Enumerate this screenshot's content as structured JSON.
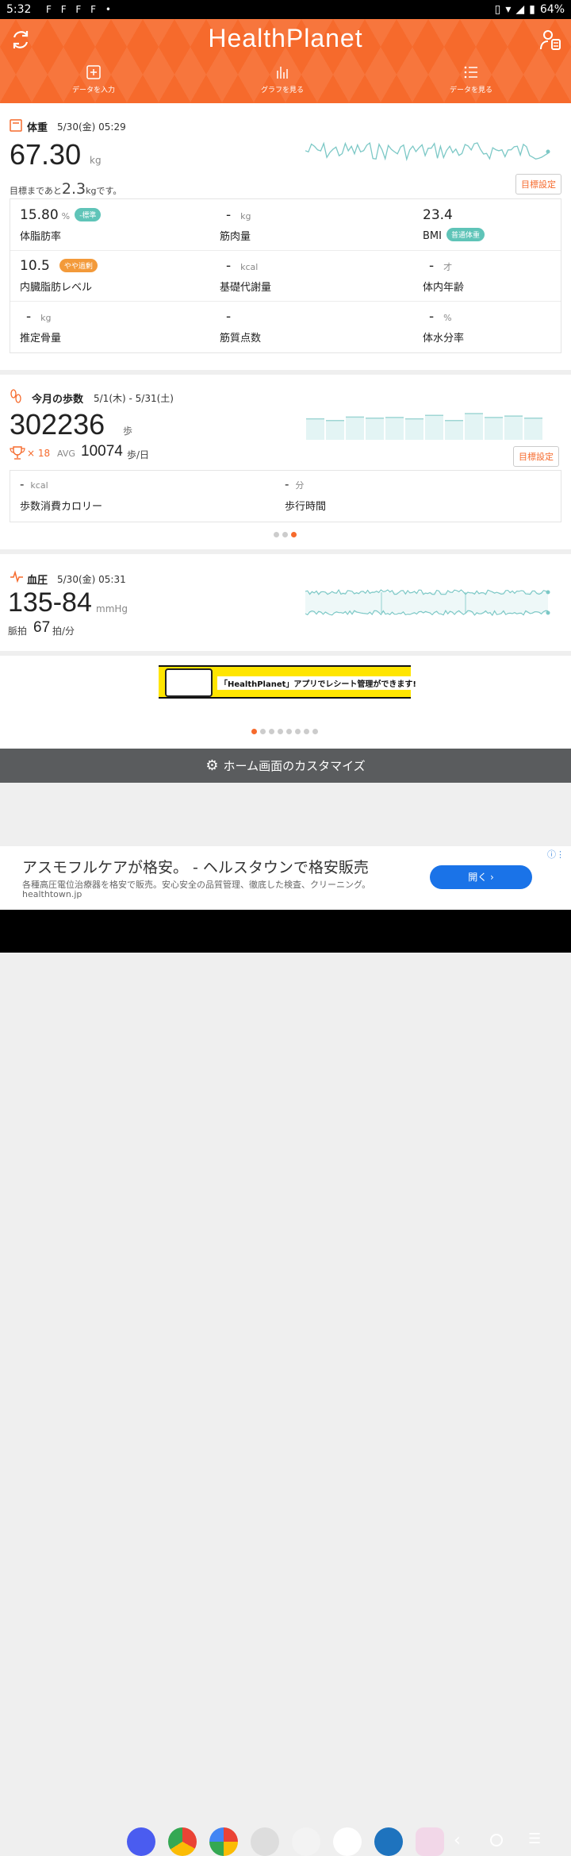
{
  "status": {
    "time": "5:32",
    "notif_icons": "F F F F •",
    "battery": "64%"
  },
  "header": {
    "title": "HealthPlanet",
    "nav": [
      {
        "label": "データを入力"
      },
      {
        "label": "グラフを見る"
      },
      {
        "label": "データを見る"
      }
    ]
  },
  "weight": {
    "title": "体重",
    "date": "5/30(金) 05:29",
    "value": "67.30",
    "unit": "kg",
    "goal_prefix": "目標まであと",
    "goal_value": "2.3",
    "goal_suffix": "kgです。",
    "goal_button": "目標設定",
    "metrics": [
      {
        "value": "15.80",
        "unit": "%",
        "badge": "-標準",
        "label": "体脂肪率"
      },
      {
        "value": "-",
        "unit": "kg",
        "label": "筋肉量"
      },
      {
        "value": "23.4",
        "unit": "",
        "label": "BMI",
        "badge": "普通体重"
      },
      {
        "value": "10.5",
        "unit": "",
        "badge": "やや過剰",
        "label": "内臓脂肪レベル"
      },
      {
        "value": "-",
        "unit": "kcal",
        "label": "基礎代謝量"
      },
      {
        "value": "-",
        "unit": "才",
        "label": "体内年齢"
      },
      {
        "value": "-",
        "unit": "kg",
        "label": "推定骨量"
      },
      {
        "value": "-",
        "unit": "",
        "label": "筋質点数"
      },
      {
        "value": "-",
        "unit": "%",
        "label": "体水分率"
      }
    ],
    "colors": {
      "badge_normal": "#5fc4b8",
      "badge_over": "#f39a3a"
    }
  },
  "steps": {
    "title": "今月の歩数",
    "date": "5/1(木) - 5/31(土)",
    "value": "302236",
    "unit": "歩",
    "trophy_count": "× 18",
    "avg_label": "AVG",
    "avg_value": "10074",
    "avg_unit": "歩/日",
    "goal_button": "目標設定",
    "calorie": {
      "value": "-",
      "unit": "kcal",
      "label": "歩数消費カロリー"
    },
    "walk_time": {
      "value": "-",
      "unit": "分",
      "label": "歩行時間"
    },
    "bar_levels": [
      0.6,
      0.55,
      0.65,
      0.62,
      0.64,
      0.6,
      0.7,
      0.55,
      0.75,
      0.64,
      0.68,
      0.62
    ]
  },
  "bp": {
    "title": "血圧",
    "date": "5/30(金) 05:31",
    "value": "135-84",
    "unit": "mmHg",
    "pulse_label": "脈拍",
    "pulse_value": "67",
    "pulse_unit": "拍/分"
  },
  "banner": {
    "text": "「HealthPlanet」アプリでレシート管理ができます!"
  },
  "customize": {
    "label": "ホーム画面のカスタマイズ"
  },
  "ad": {
    "title": "アスモフルケアが格安。 - ヘルスタウンで格安販売",
    "desc": "各種高圧電位治療器を格安で販売。安心安全の品質管理、徹底した検査、クリーニング。",
    "url": "healthtown.jp",
    "button": "開く ›"
  },
  "accent": "#f66a2c"
}
